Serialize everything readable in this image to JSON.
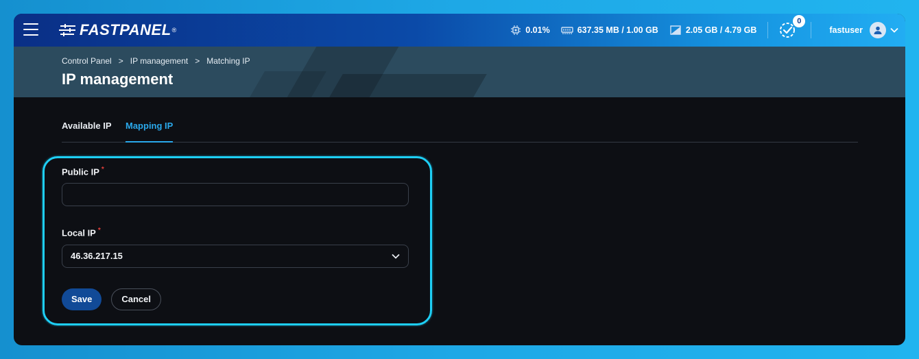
{
  "app": {
    "logo_text": "FASTPANEL",
    "logo_reg": "®"
  },
  "header": {
    "cpu": "0.01%",
    "ram": "637.35 MB / 1.00 GB",
    "disk": "2.05 GB / 4.79 GB",
    "tasks_count": "0",
    "username": "fastuser"
  },
  "breadcrumb": [
    "Control Panel",
    "IP management",
    "Matching IP"
  ],
  "breadcrumb_sep": ">",
  "page_title": "IP management",
  "tabs": [
    {
      "label": "Available IP",
      "active": false
    },
    {
      "label": "Mapping IP",
      "active": true
    }
  ],
  "form": {
    "public_ip": {
      "label": "Public IP",
      "required_mark": "*",
      "value": "",
      "placeholder": ""
    },
    "local_ip": {
      "label": "Local IP",
      "required_mark": "*",
      "value": "46.36.217.15"
    },
    "save_label": "Save",
    "cancel_label": "Cancel"
  },
  "colors": {
    "accent": "#2aa9ec",
    "primary_button": "#114a97",
    "highlight": "#1ecff6",
    "required": "#e5403b"
  },
  "icons": [
    "menu-icon",
    "cpu-icon",
    "ram-icon",
    "disk-icon",
    "tasks-check-icon",
    "user-avatar-icon",
    "chevron-down-icon"
  ]
}
